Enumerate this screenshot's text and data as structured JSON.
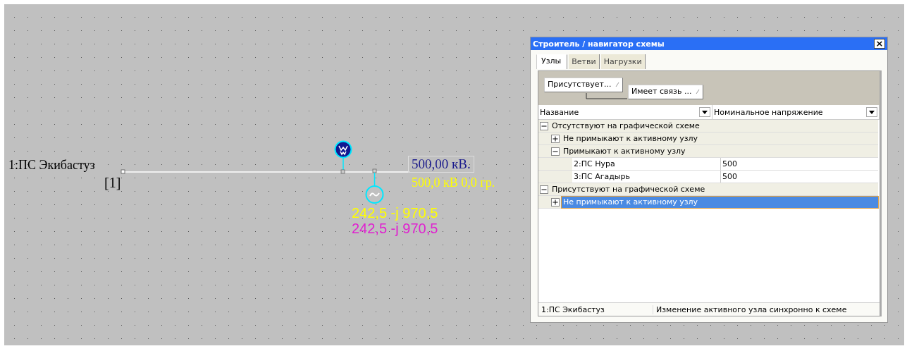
{
  "canvas": {
    "node_label": "1:ПС Экибастуз",
    "node_number": "[1]",
    "voltage_box": "500,00 кВ.",
    "voltage_reading": "500,0 кВ 0,0 гр.",
    "flows": [
      {
        "text": "242,5 -j 970,5",
        "color": "#ffff00"
      },
      {
        "text": "242,5 -j 970,5",
        "color": "#e020d0"
      }
    ]
  },
  "dialog": {
    "title": "Строитель / навигатор схемы",
    "close": "×",
    "tabs": [
      {
        "label": "Узлы",
        "selected": true
      },
      {
        "label": "Ветви",
        "selected": false
      },
      {
        "label": "Нагрузки",
        "selected": false
      }
    ],
    "group_by": [
      "Присутствует...",
      "Имеет связь ..."
    ],
    "columns": [
      "Название",
      "Номинальное напряжение"
    ],
    "tree": [
      {
        "kind": "group",
        "label": "Отсутствуют на графической схеме",
        "expanded": true,
        "selected": false,
        "children": [
          {
            "kind": "group",
            "label": "Не примыкают к активному узлу",
            "expanded": false,
            "selected": false
          },
          {
            "kind": "group",
            "label": "Примыкают к активному узлу",
            "expanded": true,
            "selected": false,
            "children": [
              {
                "kind": "node",
                "name": "2:ПС Нура",
                "voltage": "500",
                "selected": false
              },
              {
                "kind": "node",
                "name": "3:ПС Агадырь",
                "voltage": "500",
                "selected": false
              }
            ]
          }
        ]
      },
      {
        "kind": "group",
        "label": "Присутствуют на графической схеме",
        "expanded": true,
        "selected": false,
        "children": [
          {
            "kind": "group",
            "label": "Не примыкают к активному узлу",
            "expanded": false,
            "selected": true
          }
        ]
      }
    ],
    "status": [
      "1:ПС Экибастуз",
      "Изменение активного узла синхронно к схеме"
    ]
  }
}
